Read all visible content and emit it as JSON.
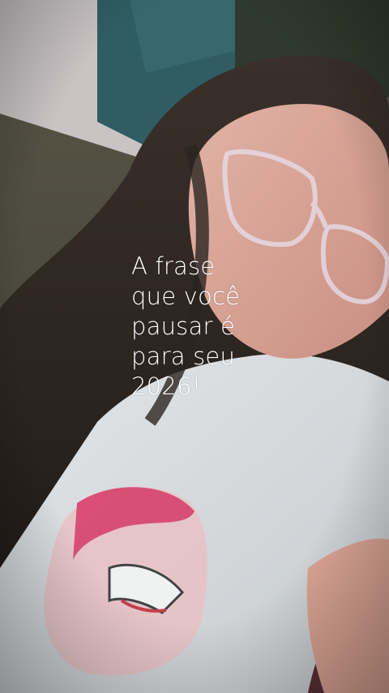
{
  "overlay": {
    "lines": [
      "A frase",
      "que você",
      "pausar é",
      "para seu",
      "2026!"
    ],
    "color": "#ffffff"
  },
  "photo": {
    "subject": "selfie",
    "palette": {
      "wall": "#c9c3c4",
      "wall_teal": "#2f5d63",
      "grass": "#4b4a3f",
      "hair": "#2a2420",
      "skin": "#d8a89a",
      "shirt": "#d9dde0",
      "ground": "#5a2e36",
      "glasses": "#e6d9e4"
    }
  }
}
